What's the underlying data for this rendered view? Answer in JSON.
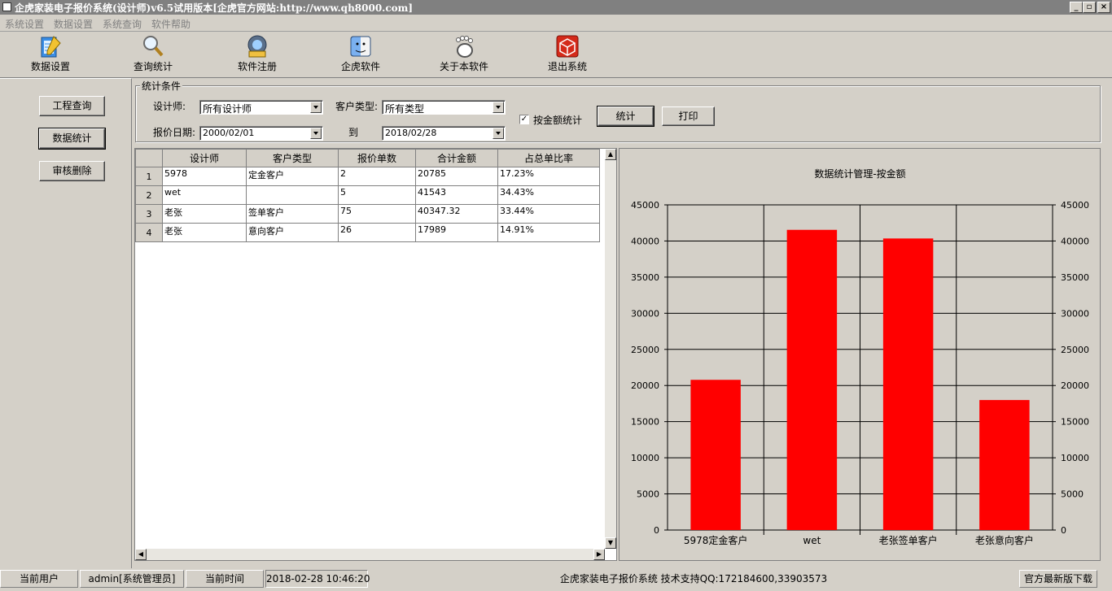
{
  "window": {
    "title": "企虎家装电子报价系统(设计师)v6.5试用版本[企虎官方网站:http://www.qh8000.com]",
    "controls": [
      "_",
      "▫",
      "×"
    ]
  },
  "menu": [
    "系统设置",
    "数据设置",
    "系统查询",
    "软件帮助"
  ],
  "toolbar": [
    {
      "label": "数据设置",
      "icon": "notepad-pencil-icon"
    },
    {
      "label": "查询统计",
      "icon": "magnifier-icon"
    },
    {
      "label": "软件注册",
      "icon": "register-badge-icon"
    },
    {
      "label": "企虎软件",
      "icon": "finder-face-icon"
    },
    {
      "label": "关于本软件",
      "icon": "gnome-foot-icon"
    },
    {
      "label": "退出系统",
      "icon": "red-cube-icon"
    }
  ],
  "sidebar": {
    "buttons": [
      "工程查询",
      "数据统计",
      "审核删除"
    ]
  },
  "filters": {
    "group_title": "统计条件",
    "designer_label": "设计师:",
    "designer_value": "所有设计师",
    "customer_type_label": "客户类型:",
    "customer_type_value": "所有类型",
    "date_label": "报价日期:",
    "date_from": "2000/02/01",
    "date_to_label": "到",
    "date_to": "2018/02/28",
    "amount_checkbox_label": "按金额统计",
    "amount_checked": true,
    "stat_button": "统计",
    "print_button": "打印"
  },
  "table": {
    "headers": [
      "设计师",
      "客户类型",
      "报价单数",
      "合计金额",
      "占总单比率"
    ],
    "rows": [
      {
        "n": "1",
        "designer": "5978",
        "type": "定金客户",
        "count": "2",
        "amount": "20785",
        "ratio": "17.23%"
      },
      {
        "n": "2",
        "designer": "wet",
        "type": "",
        "count": "5",
        "amount": "41543",
        "ratio": "34.43%"
      },
      {
        "n": "3",
        "designer": "老张",
        "type": "签单客户",
        "count": "75",
        "amount": "40347.32",
        "ratio": "33.44%"
      },
      {
        "n": "4",
        "designer": "老张",
        "type": "意向客户",
        "count": "26",
        "amount": "17989",
        "ratio": "14.91%"
      }
    ]
  },
  "chart_data": {
    "type": "bar",
    "title": "数据统计管理-按金额",
    "categories": [
      "5978定金客户",
      "wet",
      "老张签单客户",
      "老张意向客户"
    ],
    "values": [
      20785,
      41543,
      40347.32,
      17989
    ],
    "ylim": [
      0,
      45000
    ],
    "yticks": [
      0,
      5000,
      10000,
      15000,
      20000,
      25000,
      30000,
      35000,
      40000,
      45000
    ],
    "bar_color": "#ff0000",
    "grid": true,
    "right_axis": true
  },
  "status": {
    "user_label": "当前用户",
    "user_value": "admin[系统管理员]",
    "time_label": "当前时间",
    "time_value": "2018-02-28 10:46:20",
    "system_info": "企虎家装电子报价系统  技术支持QQ:172184600,33903573",
    "download_button": "官方最新版下载"
  }
}
